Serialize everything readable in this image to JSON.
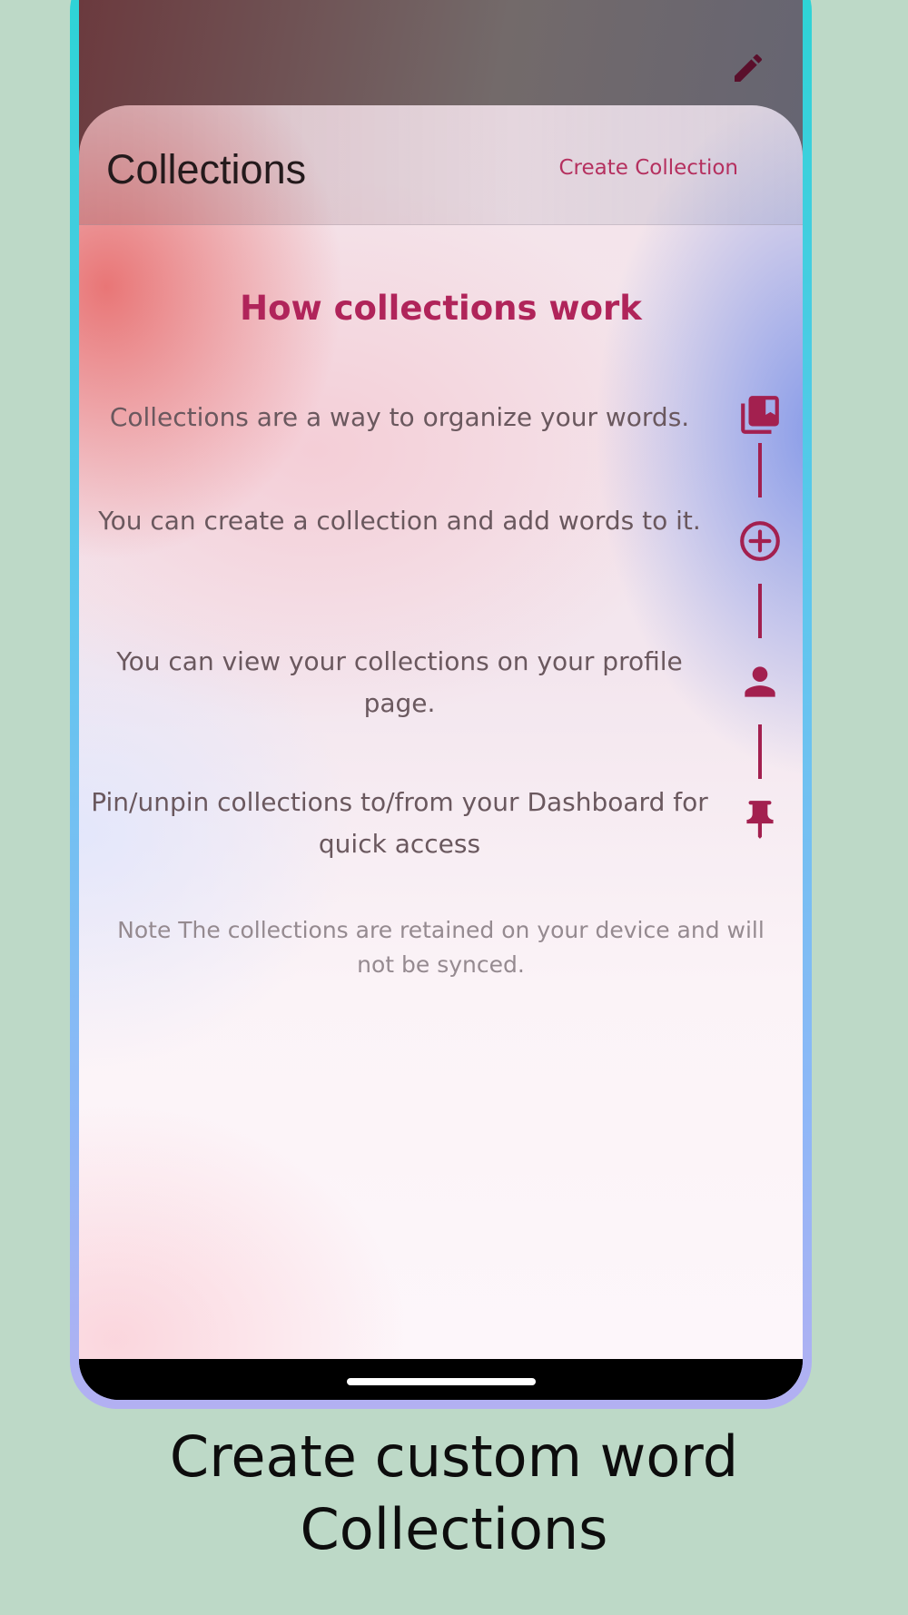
{
  "header": {
    "title": "Collections",
    "create_label": "Create Collection"
  },
  "how_it_works": {
    "heading": "How collections work",
    "items": [
      {
        "text": "Collections are a way to organize your words.",
        "icon": "collections-bookmark-icon"
      },
      {
        "text": "You can create a collection and add words to it.",
        "icon": "add-circle-icon"
      },
      {
        "text": "You can view your collections on your profile page.",
        "icon": "person-icon"
      },
      {
        "text": "Pin/unpin collections to/from your Dashboard for quick access",
        "icon": "pin-icon"
      }
    ]
  },
  "note": "Note The collections are retained on your device and will not be synced.",
  "caption": {
    "line1": "Create custom word",
    "line2": "Collections"
  },
  "colors": {
    "accent": "#b0245a",
    "icon": "#a3204f",
    "page_background": "#bdd9c7"
  }
}
